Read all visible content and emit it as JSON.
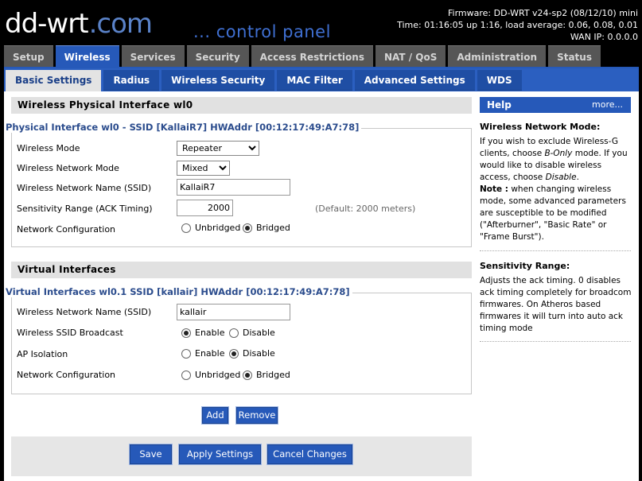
{
  "header": {
    "logo_main": "dd-wrt",
    "logo_suffix": ".com",
    "subtitle": "... control panel",
    "firmware": "Firmware: DD-WRT v24-sp2 (08/12/10) mini",
    "time": "Time: 01:16:05 up 1:16, load average: 0.06, 0.08, 0.01",
    "wan_ip": "WAN IP: 0.0.0.0"
  },
  "main_tabs": [
    "Setup",
    "Wireless",
    "Services",
    "Security",
    "Access Restrictions",
    "NAT / QoS",
    "Administration",
    "Status"
  ],
  "active_main_tab": "Wireless",
  "sub_tabs": [
    "Basic Settings",
    "Radius",
    "Wireless Security",
    "MAC Filter",
    "Advanced Settings",
    "WDS"
  ],
  "active_sub_tab": "Basic Settings",
  "physical": {
    "section_title": "Wireless Physical Interface wl0",
    "fieldset_title": "Physical Interface wl0 - SSID [KallaiR7] HWAddr [00:12:17:49:A7:78]",
    "wireless_mode_label": "Wireless Mode",
    "wireless_mode_value": "Repeater",
    "network_mode_label": "Wireless Network Mode",
    "network_mode_value": "Mixed",
    "ssid_label": "Wireless Network Name (SSID)",
    "ssid_value": "KallaiR7",
    "sensitivity_label": "Sensitivity Range (ACK Timing)",
    "sensitivity_value": "2000",
    "sensitivity_default": "(Default: 2000 meters)",
    "netconfig_label": "Network Configuration",
    "unbridged_label": "Unbridged",
    "bridged_label": "Bridged",
    "netconfig_selected": "Bridged"
  },
  "virtual": {
    "section_title": "Virtual Interfaces",
    "fieldset_title": "Virtual Interfaces wl0.1 SSID [kallair] HWAddr [00:12:17:49:A7:78]",
    "ssid_label": "Wireless Network Name (SSID)",
    "ssid_value": "kallair",
    "broadcast_label": "Wireless SSID Broadcast",
    "broadcast_selected": "Enable",
    "isolation_label": "AP Isolation",
    "isolation_selected": "Disable",
    "netconfig_label": "Network Configuration",
    "netconfig_selected": "Bridged",
    "enable_label": "Enable",
    "disable_label": "Disable",
    "unbridged_label": "Unbridged",
    "bridged_label": "Bridged",
    "add_label": "Add",
    "remove_label": "Remove"
  },
  "footer": {
    "save_label": "Save",
    "apply_label": "Apply Settings",
    "cancel_label": "Cancel Changes"
  },
  "help": {
    "title": "Help",
    "more": "more...",
    "mode_title": "Wireless Network Mode:",
    "mode_text_1": "If you wish to exclude Wireless-G clients, choose ",
    "mode_text_bonly": "B-Only",
    "mode_text_2": " mode. If you would like to disable wireless access, choose ",
    "mode_text_disable": "Disable",
    "mode_text_3": ".",
    "note_label": "Note :",
    "note_text": " when changing wireless mode, some advanced parameters are susceptible to be modified (\"Afterburner\", \"Basic Rate\" or \"Frame Burst\").",
    "sens_title": "Sensitivity Range:",
    "sens_text": "Adjusts the ack timing. 0 disables ack timing completely for broadcom firmwares. On Atheros based firmwares it will turn into auto ack timing mode"
  }
}
